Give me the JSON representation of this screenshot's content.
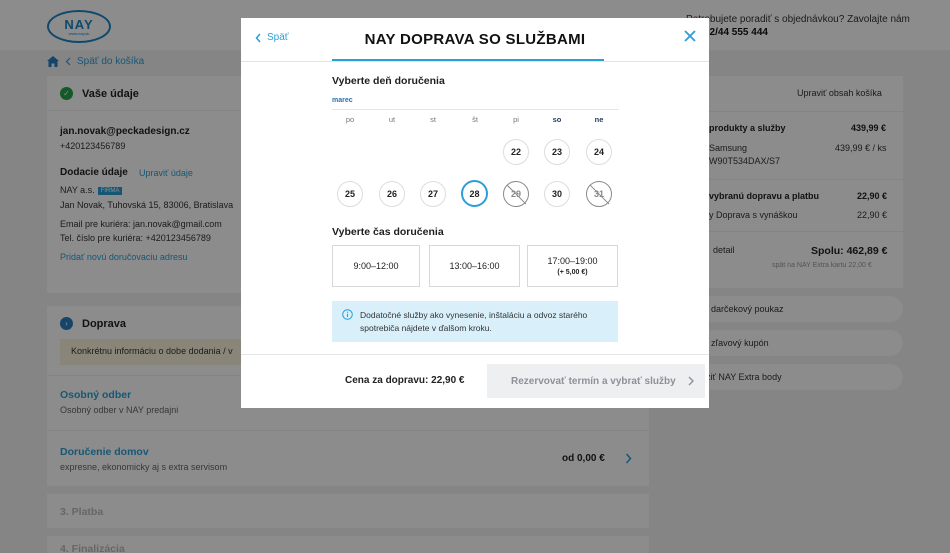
{
  "header": {
    "logo": "NAY",
    "logo_sub": "www.nay.sk",
    "help_text": "Potrebujete poradiť s objednávkou? Zavolajte nám",
    "help_phone": "02/44 555 444"
  },
  "breadcrumb": {
    "back_label": "Späť do košíka"
  },
  "details": {
    "title": "Vaše údaje",
    "email": "jan.novak@peckadesign.cz",
    "phone": "+420123456789",
    "delivery_label": "Dodacie údaje",
    "edit_link": "Upraviť údaje",
    "company": "NAY a.s.",
    "company_badge": "FIRMA",
    "address": "Jan Novak, Tuhovská 15, 83006, Bratislava",
    "courier_email": "Email pre kuriéra: jan.novak@gmail.com",
    "courier_phone": "Tel. číslo pre kuriéra: +420123456789",
    "add_address": "Pridať novú doručovaciu adresu"
  },
  "shipping": {
    "title": "Doprava",
    "note": "Konkrétnu informáciu o dobe dodania / v",
    "options": [
      {
        "label": "Osobný odber",
        "desc": "Osobný odber v NAY predajni"
      },
      {
        "label": "Doručenie domov",
        "desc": "expresne, ekonomicky aj s extra servisom",
        "price": "od 0,00 €"
      }
    ]
  },
  "steps": {
    "payment": "3. Platba",
    "finalize": "4. Finalizácia"
  },
  "summary": {
    "edit_cart": "Upraviť obsah košíka",
    "products_label": "produkty a služby",
    "products_total": "439,99 €",
    "item_brand": "Samsung",
    "item_model": "W90T534DAX/S7",
    "item_price": "439,99 € / ks",
    "shipping_label": "vybranú dopravu a platbu",
    "shipping_total": "22,90 €",
    "shipping_item": "y Doprava s vynáškou",
    "shipping_item_price": "22,90 €",
    "detail_link": "detail",
    "total": "Spolu: 462,89 €",
    "extra_card": "spät na NAY Extra kartu 22,00 €",
    "gift": "darčekový poukaz",
    "coupon": "zľavový kupón",
    "nay_extra": "ziť NAY Extra body"
  },
  "modal": {
    "back": "Späť",
    "title": "NAY DOPRAVA SO SLUŽBAMI",
    "day_heading": "Vyberte deň doručenia",
    "month": "marec",
    "weekdays": [
      "po",
      "ut",
      "st",
      "št",
      "pi",
      "so",
      "ne"
    ],
    "week1": [
      "22",
      "23",
      "24"
    ],
    "week2": [
      "25",
      "26",
      "27",
      "28",
      "29",
      "30",
      "31"
    ],
    "time_heading": "Vyberte čas doručenia",
    "slots": [
      {
        "time": "9:00–12:00"
      },
      {
        "time": "13:00–16:00"
      },
      {
        "time": "17:00–19:00",
        "extra": "(+ 5,00 €)"
      }
    ],
    "info": "Dodatočné služby ako vynesenie, inštaláciu a odvoz starého spotrebiča nájdete v ďalšom kroku.",
    "price": "Cena za dopravu: 22,90 €",
    "reserve": "Rezervovať termín a vybrať služby",
    "accent": "#2a9fd8"
  }
}
